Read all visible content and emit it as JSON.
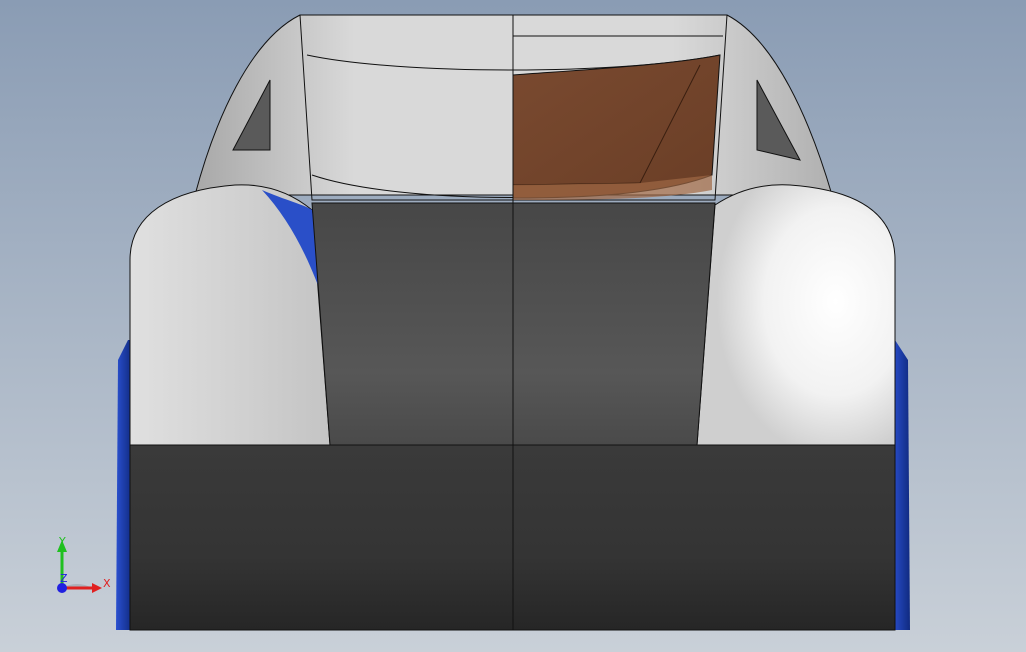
{
  "viewport": {
    "background_top": "#8b9db5",
    "background_bottom": "#c7ced6",
    "view_cube": "front"
  },
  "model": {
    "colors": {
      "body_white": "#d6d6d6",
      "body_white_highlight": "#ffffff",
      "panel_dark": "#4a4a4a",
      "panel_dark_bottom": "#2e2e2e",
      "accent_blue": "#1e3fa8",
      "glass_brown": "#7a4a30",
      "edge_line": "#000000"
    }
  },
  "triad": {
    "x_label": "X",
    "y_label": "Y",
    "z_label": "Z",
    "x_color": "#e02020",
    "y_color": "#20c020",
    "z_color": "#2020e0"
  }
}
